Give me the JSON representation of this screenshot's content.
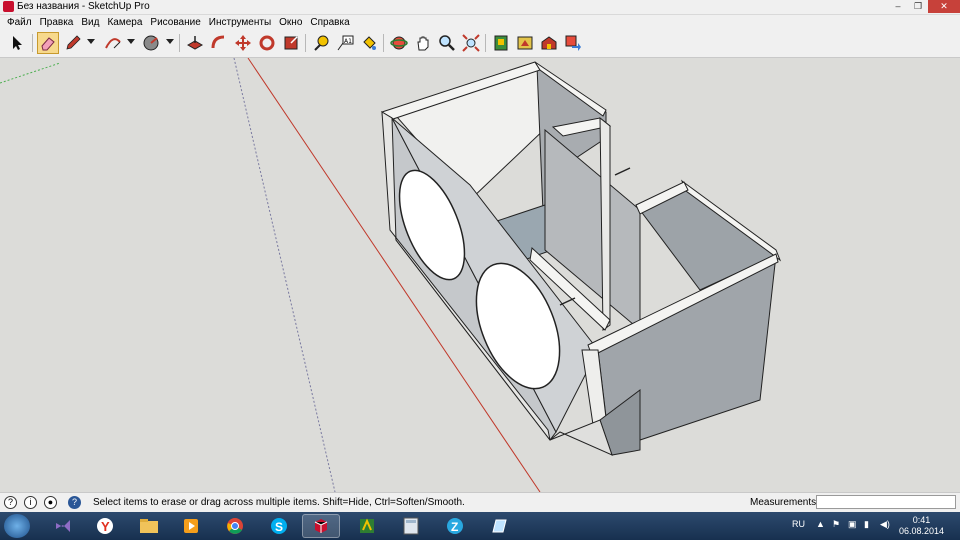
{
  "window": {
    "title": "Без названия - SketchUp Pro",
    "controls": [
      "–",
      "❐",
      "✕"
    ]
  },
  "menu": [
    "Файл",
    "Правка",
    "Вид",
    "Камера",
    "Рисование",
    "Инструменты",
    "Окно",
    "Справка"
  ],
  "status": {
    "message": "Select items to erase or drag across multiple items. Shift=Hide, Ctrl=Soften/Smooth.",
    "measurements_label": "Measurements",
    "measurements_value": ""
  },
  "taskbar": {
    "apps": [
      "visual-studio-icon",
      "yandex-browser-icon",
      "file-explorer-icon",
      "media-player-icon",
      "chrome-icon",
      "skype-icon",
      "sketchup-icon",
      "app-icon",
      "calculator-icon",
      "zona-icon",
      "notes-icon"
    ],
    "language": "RU",
    "time": "0:41",
    "date": "06.08.2014"
  },
  "colors": {
    "viewport_bg": "#dcdcd9",
    "accent_active_tool": "#f7d98c",
    "taskbar": "#1f3b5e"
  }
}
